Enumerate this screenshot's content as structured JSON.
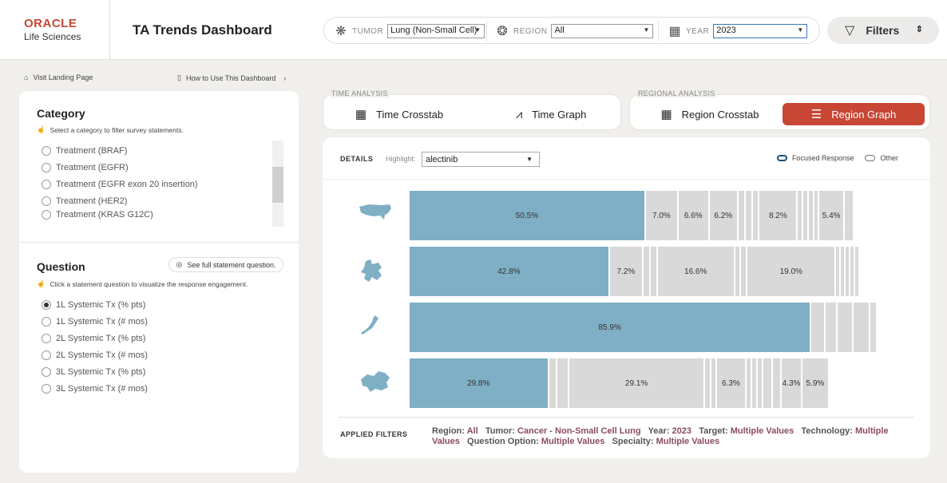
{
  "header": {
    "brand_line1": "ORACLE",
    "brand_line2": "Life Sciences",
    "title": "TA Trends Dashboard",
    "filters": {
      "tumor": {
        "label": "TUMOR",
        "value": "Lung (Non-Small Cell)"
      },
      "region": {
        "label": "REGION",
        "value": "All"
      },
      "year": {
        "label": "YEAR",
        "value": "2023"
      }
    },
    "filters_button": "Filters"
  },
  "nav": {
    "landing": "Visit Landing Page",
    "howto": "How to Use This Dashboard"
  },
  "category": {
    "title": "Category",
    "hint": "Select a category to filter survey statements.",
    "items": [
      "Treatment (BRAF)",
      "Treatment (EGFR)",
      "Treatment (EGFR exon 20 insertion)",
      "Treatment (HER2)",
      "Treatment (KRAS G12C)"
    ]
  },
  "question": {
    "title": "Question",
    "see_button": "See full statement question.",
    "hint": "Click a statement question to visualize the response engagement.",
    "items": [
      "1L Systemic Tx (% pts)",
      "1L Systemic Tx (# mos)",
      "2L Systemic Tx (% pts)",
      "2L Systemic Tx (# mos)",
      "3L Systemic Tx (% pts)",
      "3L Systemic Tx (# mos)"
    ],
    "selected_index": 0
  },
  "tabs": {
    "time_legend": "TIME ANALYSIS",
    "time_crosstab": "Time Crosstab",
    "time_graph": "Time Graph",
    "regional_legend": "REGIONAL ANALYSIS",
    "region_crosstab": "Region Crosstab",
    "region_graph": "Region Graph",
    "active": "region_graph"
  },
  "details": {
    "label": "DETAILS",
    "highlight_label": "Highlight:",
    "highlight_value": "alectinib",
    "legend_focused": "Focused Response",
    "legend_other": "Other"
  },
  "colors": {
    "accent": "#c74634",
    "focused": "#7fafc4",
    "other": "#d9d9d9",
    "filter_value": "#8b4b5c"
  },
  "chart_data": {
    "type": "bar",
    "orientation": "horizontal-stacked",
    "categories": [
      "us-map-icon",
      "europe-map-icon",
      "japan-map-icon",
      "china-map-icon"
    ],
    "rows": [
      {
        "icon": "us-map-icon",
        "segments": [
          {
            "value": 50.5,
            "label": "50.5%",
            "focus": true
          },
          {
            "value": 7.0,
            "label": "7.0%"
          },
          {
            "value": 6.6,
            "label": "6.6%"
          },
          {
            "value": 6.2,
            "label": "6.2%"
          },
          {
            "value": 1.5,
            "label": ""
          },
          {
            "value": 1.5,
            "label": ""
          },
          {
            "value": 1.5,
            "label": ""
          },
          {
            "value": 8.2,
            "label": "8.2%"
          },
          {
            "value": 1.2,
            "label": ""
          },
          {
            "value": 1.2,
            "label": ""
          },
          {
            "value": 1.2,
            "label": ""
          },
          {
            "value": 1.0,
            "label": ""
          },
          {
            "value": 5.4,
            "label": "5.4%"
          },
          {
            "value": 2.0,
            "label": ""
          }
        ]
      },
      {
        "icon": "europe-map-icon",
        "segments": [
          {
            "value": 42.8,
            "label": "42.8%",
            "focus": true
          },
          {
            "value": 7.2,
            "label": "7.2%"
          },
          {
            "value": 1.5,
            "label": ""
          },
          {
            "value": 1.5,
            "label": ""
          },
          {
            "value": 16.6,
            "label": "16.6%"
          },
          {
            "value": 1.3,
            "label": ""
          },
          {
            "value": 1.3,
            "label": ""
          },
          {
            "value": 19.0,
            "label": "19.0%"
          },
          {
            "value": 1.0,
            "label": ""
          },
          {
            "value": 1.0,
            "label": ""
          },
          {
            "value": 1.0,
            "label": ""
          },
          {
            "value": 1.0,
            "label": ""
          },
          {
            "value": 1.0,
            "label": ""
          }
        ]
      },
      {
        "icon": "japan-map-icon",
        "segments": [
          {
            "value": 85.9,
            "label": "85.9%",
            "focus": true
          },
          {
            "value": 3.0,
            "label": ""
          },
          {
            "value": 2.5,
            "label": ""
          },
          {
            "value": 3.5,
            "label": ""
          },
          {
            "value": 3.5,
            "label": ""
          },
          {
            "value": 1.6,
            "label": ""
          }
        ]
      },
      {
        "icon": "china-map-icon",
        "segments": [
          {
            "value": 29.8,
            "label": "29.8%",
            "focus": true
          },
          {
            "value": 1.8,
            "label": ""
          },
          {
            "value": 2.5,
            "label": ""
          },
          {
            "value": 29.1,
            "label": "29.1%"
          },
          {
            "value": 1.3,
            "label": ""
          },
          {
            "value": 1.2,
            "label": ""
          },
          {
            "value": 6.3,
            "label": "6.3%"
          },
          {
            "value": 1.2,
            "label": ""
          },
          {
            "value": 1.2,
            "label": ""
          },
          {
            "value": 1.2,
            "label": ""
          },
          {
            "value": 2.0,
            "label": ""
          },
          {
            "value": 2.0,
            "label": ""
          },
          {
            "value": 4.3,
            "label": "4.3%"
          },
          {
            "value": 5.9,
            "label": "5.9%"
          }
        ]
      }
    ],
    "max": 100
  },
  "applied_filters": {
    "label": "APPLIED FILTERS",
    "items": [
      {
        "k": "Region: ",
        "v": "All"
      },
      {
        "k": "Tumor: ",
        "v": "Cancer - Non-Small Cell Lung"
      },
      {
        "k": "Year: ",
        "v": "2023"
      },
      {
        "k": "Target: ",
        "v": "Multiple Values"
      },
      {
        "k": "Technology: ",
        "v": "Multiple Values"
      },
      {
        "k": "Question Option: ",
        "v": "Multiple Values"
      },
      {
        "k": "Specialty: ",
        "v": "Multiple Values"
      }
    ]
  }
}
